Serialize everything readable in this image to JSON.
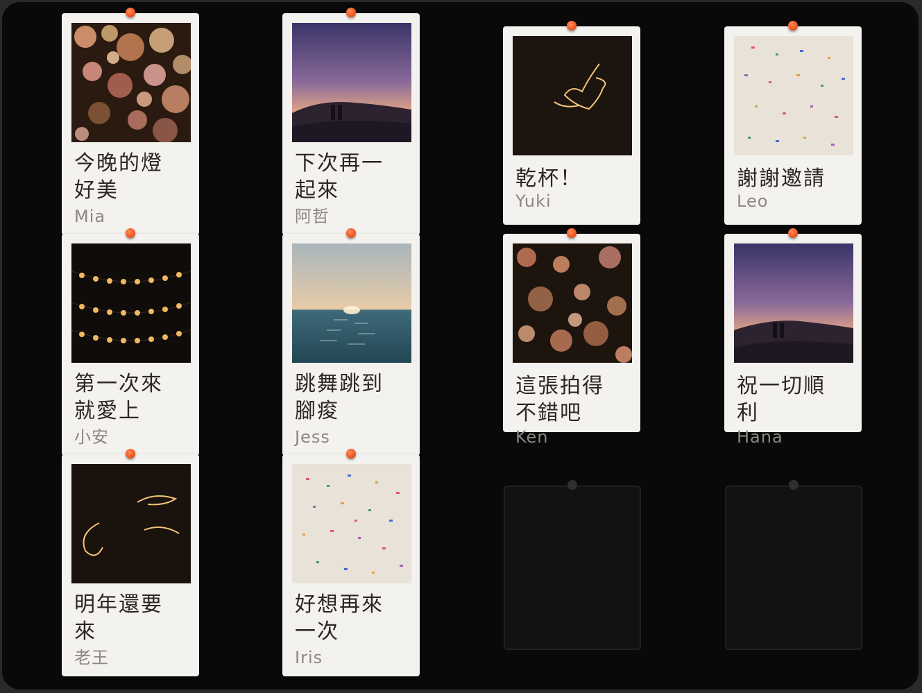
{
  "board": {
    "columns": [
      {
        "cards": [
          {
            "message": [
              "今晚的燈",
              "好美"
            ],
            "author": "Mia",
            "photo": "bokeh-warm-icon"
          },
          {
            "message": [
              "第一次來",
              "就愛上"
            ],
            "author": "小安",
            "photo": "string-lights-icon"
          },
          {
            "message": [
              "明年還要",
              "來"
            ],
            "author": "老王",
            "photo": "sparkler-trail-icon"
          }
        ]
      },
      {
        "cards": [
          {
            "message": [
              "下次再一",
              "起來"
            ],
            "author": "阿哲",
            "photo": "sunset-hills-couple-icon"
          },
          {
            "message": [
              "跳舞跳到",
              "腳痠"
            ],
            "author": "Jess",
            "photo": "sea-sunset-icon"
          },
          {
            "message": [
              "好想再來",
              "一次"
            ],
            "author": "Iris",
            "photo": "confetti-icon"
          }
        ]
      },
      {
        "cards": [
          {
            "message": [
              "乾杯！"
            ],
            "author": "Yuki",
            "photo": "sparkler-heart-icon"
          },
          {
            "message": [
              "這張拍得",
              "不錯吧"
            ],
            "author": "Ken",
            "photo": "bokeh-dark-icon"
          }
        ],
        "empty_slot": true
      },
      {
        "cards": [
          {
            "message": [
              "謝謝邀請"
            ],
            "author": "Leo",
            "photo": "confetti-icon"
          },
          {
            "message": [
              "祝一切順",
              "利"
            ],
            "author": "Hana",
            "photo": "sunset-hills-couple-icon"
          }
        ],
        "empty_slot": true
      }
    ]
  },
  "colors": {
    "pin": "#f05a24",
    "card": "#f4f2ee",
    "board": "#090909",
    "text": "#2b2724",
    "author": "#8d8781"
  }
}
